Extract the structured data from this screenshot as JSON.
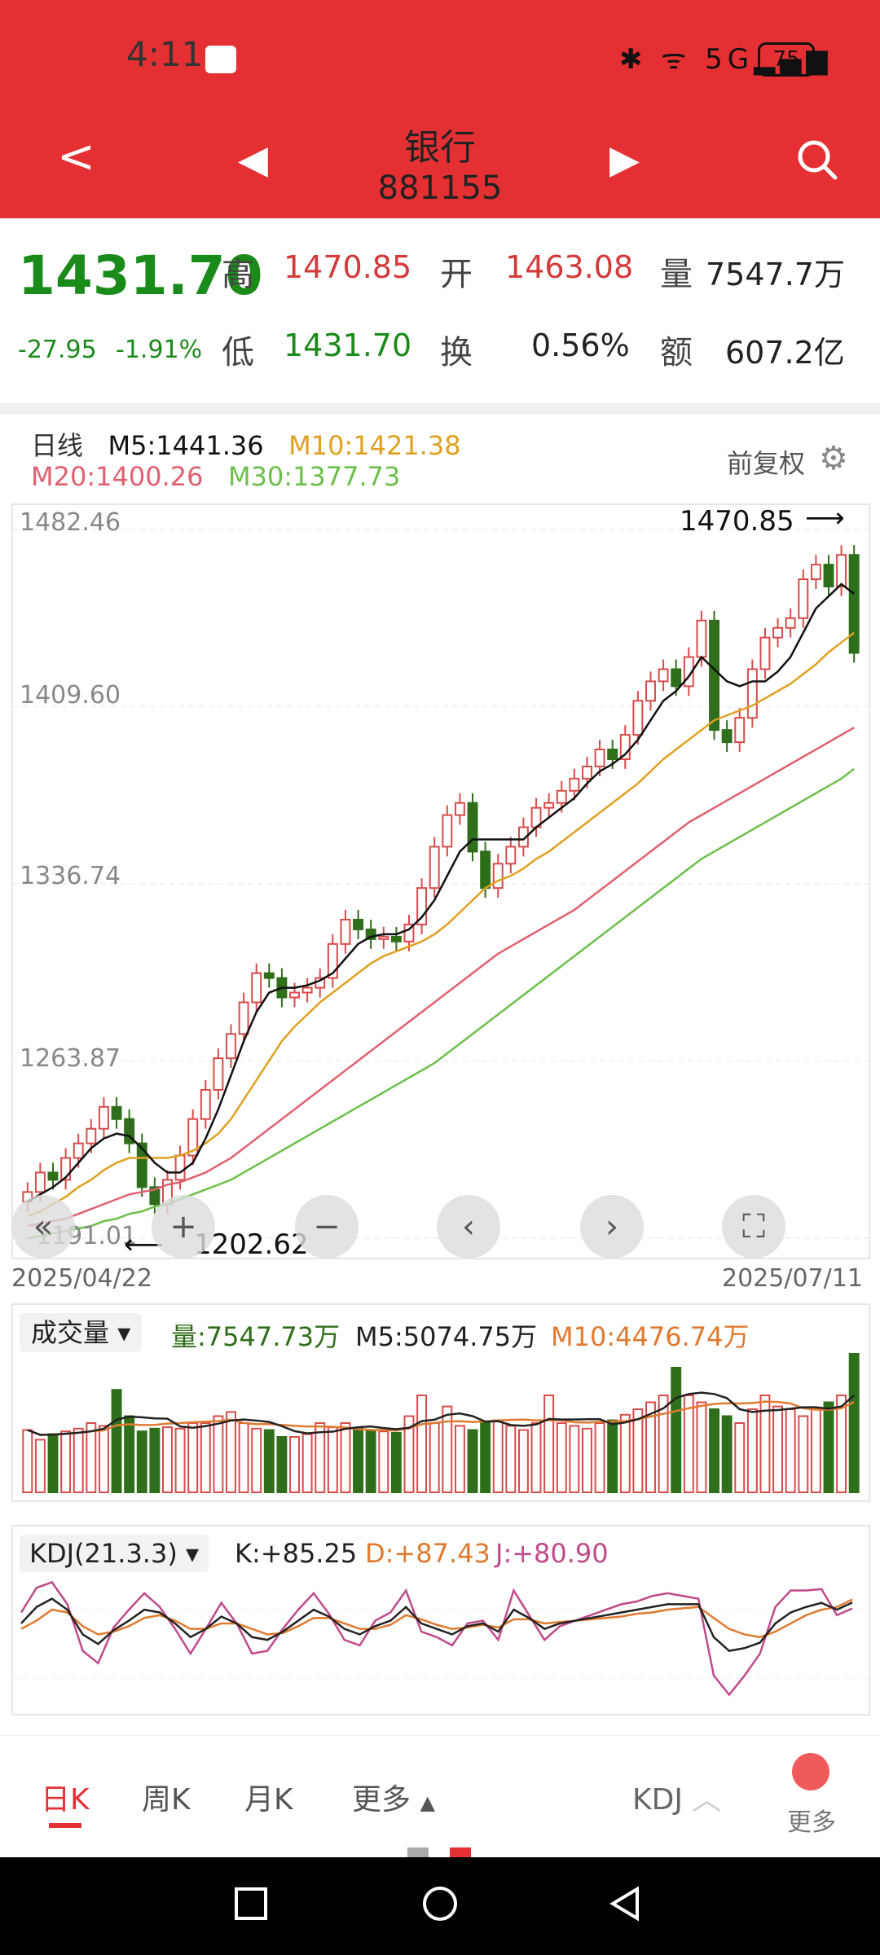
{
  "status": {
    "time": "4:11",
    "battery": "75",
    "net": "5G"
  },
  "header": {
    "title": "银行",
    "code": "881155",
    "back": "<",
    "prev": "◀",
    "next": "▶"
  },
  "quote": {
    "price": "1431.70",
    "change": "-27.95",
    "pct": "-1.91%",
    "high_label": "高",
    "high": "1470.85",
    "open_label": "开",
    "open": "1463.08",
    "vol_label": "量",
    "vol": "7547.7万",
    "low_label": "低",
    "low": "1431.70",
    "turn_label": "换",
    "turn": "0.56%",
    "amt_label": "额",
    "amt": "607.2亿"
  },
  "chart_header": {
    "period": "日线",
    "m5": "M5:1441.36",
    "m10": "M10:1421.38",
    "m20": "M20:1400.26",
    "m30": "M30:1377.73",
    "adjust": "前复权"
  },
  "chart_data": {
    "type": "candlestick",
    "y_ticks": [
      "1482.46",
      "1409.60",
      "1336.74",
      "1263.87",
      "1191.01"
    ],
    "ylim": [
      1191.01,
      1482.46
    ],
    "max_label": "1470.85",
    "min_label": "1202.62",
    "start_date": "2025/04/22",
    "end_date": "2025/07/11",
    "closes": [
      1210,
      1218,
      1215,
      1224,
      1230,
      1236,
      1245,
      1240,
      1230,
      1212,
      1205,
      1215,
      1225,
      1240,
      1252,
      1265,
      1275,
      1288,
      1300,
      1298,
      1290,
      1292,
      1294,
      1298,
      1312,
      1322,
      1318,
      1314,
      1315,
      1313,
      1320,
      1335,
      1352,
      1365,
      1370,
      1350,
      1335,
      1345,
      1352,
      1360,
      1368,
      1370,
      1375,
      1380,
      1385,
      1392,
      1388,
      1398,
      1412,
      1420,
      1425,
      1418,
      1430,
      1445,
      1400,
      1395,
      1405,
      1425,
      1438,
      1442,
      1446,
      1462,
      1468,
      1459,
      1472,
      1431.7
    ],
    "m5": [
      1206,
      1209,
      1212,
      1216,
      1222,
      1228,
      1232,
      1234,
      1233,
      1228,
      1222,
      1218,
      1218,
      1222,
      1232,
      1244,
      1258,
      1272,
      1284,
      1292,
      1294,
      1294,
      1295,
      1297,
      1300,
      1306,
      1312,
      1315,
      1316,
      1316,
      1318,
      1323,
      1330,
      1340,
      1350,
      1355,
      1355,
      1355,
      1355,
      1355,
      1360,
      1364,
      1368,
      1372,
      1378,
      1383,
      1386,
      1390,
      1396,
      1404,
      1412,
      1416,
      1422,
      1430,
      1425,
      1420,
      1418,
      1420,
      1420,
      1424,
      1430,
      1440,
      1450,
      1455,
      1460,
      1456
    ],
    "m10": [
      1200,
      1202,
      1205,
      1208,
      1212,
      1215,
      1219,
      1222,
      1224,
      1224,
      1224,
      1224,
      1225,
      1227,
      1230,
      1234,
      1240,
      1248,
      1256,
      1264,
      1272,
      1278,
      1283,
      1288,
      1292,
      1296,
      1300,
      1304,
      1307,
      1309,
      1311,
      1313,
      1316,
      1320,
      1325,
      1330,
      1335,
      1338,
      1340,
      1343,
      1347,
      1350,
      1354,
      1358,
      1362,
      1366,
      1370,
      1374,
      1378,
      1383,
      1388,
      1392,
      1396,
      1400,
      1404,
      1406,
      1408,
      1410,
      1413,
      1416,
      1419,
      1423,
      1427,
      1432,
      1436,
      1440
    ],
    "m20": [
      1196,
      1197,
      1198,
      1199,
      1201,
      1203,
      1205,
      1207,
      1209,
      1210,
      1211,
      1213,
      1214,
      1216,
      1218,
      1221,
      1224,
      1228,
      1232,
      1236,
      1240,
      1244,
      1248,
      1252,
      1256,
      1260,
      1264,
      1268,
      1272,
      1276,
      1280,
      1284,
      1288,
      1292,
      1296,
      1300,
      1304,
      1308,
      1311,
      1314,
      1317,
      1320,
      1323,
      1326,
      1330,
      1334,
      1338,
      1342,
      1346,
      1350,
      1354,
      1358,
      1362,
      1365,
      1368,
      1371,
      1374,
      1377,
      1380,
      1383,
      1386,
      1389,
      1392,
      1395,
      1398,
      1401
    ],
    "m30": [
      1191,
      1192,
      1193,
      1194,
      1195,
      1196,
      1198,
      1199,
      1201,
      1202,
      1204,
      1205,
      1207,
      1209,
      1211,
      1213,
      1215,
      1218,
      1221,
      1224,
      1227,
      1230,
      1233,
      1236,
      1239,
      1242,
      1245,
      1248,
      1251,
      1254,
      1257,
      1260,
      1263,
      1267,
      1271,
      1275,
      1279,
      1283,
      1287,
      1291,
      1295,
      1299,
      1303,
      1307,
      1311,
      1315,
      1319,
      1323,
      1327,
      1331,
      1335,
      1339,
      1343,
      1347,
      1350,
      1353,
      1356,
      1359,
      1362,
      1365,
      1368,
      1371,
      1374,
      1377,
      1380,
      1384
    ],
    "volumes": [
      0.45,
      0.38,
      0.42,
      0.44,
      0.46,
      0.5,
      0.48,
      0.74,
      0.55,
      0.44,
      0.46,
      0.47,
      0.46,
      0.5,
      0.5,
      0.55,
      0.58,
      0.5,
      0.46,
      0.45,
      0.4,
      0.4,
      0.42,
      0.5,
      0.47,
      0.5,
      0.46,
      0.45,
      0.44,
      0.43,
      0.55,
      0.7,
      0.5,
      0.62,
      0.48,
      0.45,
      0.5,
      0.52,
      0.48,
      0.45,
      0.5,
      0.7,
      0.5,
      0.48,
      0.46,
      0.5,
      0.52,
      0.56,
      0.6,
      0.65,
      0.7,
      0.9,
      0.7,
      0.65,
      0.6,
      0.55,
      0.5,
      0.6,
      0.7,
      0.62,
      0.6,
      0.55,
      0.6,
      0.65,
      0.7,
      1.0
    ],
    "K": [
      70,
      82,
      88,
      80,
      62,
      55,
      65,
      72,
      80,
      78,
      70,
      60,
      66,
      75,
      70,
      60,
      58,
      64,
      72,
      80,
      75,
      66,
      62,
      68,
      72,
      82,
      70,
      66,
      62,
      68,
      70,
      64,
      80,
      74,
      66,
      70,
      72,
      74,
      76,
      78,
      80,
      82,
      84,
      84,
      84,
      60,
      50,
      52,
      56,
      70,
      78,
      82,
      85,
      80,
      85.25
    ],
    "D": [
      66,
      72,
      80,
      78,
      68,
      62,
      64,
      68,
      74,
      76,
      72,
      66,
      66,
      70,
      70,
      66,
      62,
      63,
      68,
      74,
      74,
      70,
      66,
      66,
      69,
      76,
      73,
      69,
      66,
      67,
      69,
      67,
      73,
      73,
      70,
      71,
      72,
      73,
      74,
      75,
      77,
      78,
      80,
      81,
      82,
      74,
      66,
      62,
      60,
      64,
      70,
      76,
      80,
      82,
      87.43
    ],
    "J": [
      78,
      96,
      100,
      84,
      50,
      41,
      67,
      80,
      92,
      82,
      66,
      48,
      66,
      85,
      70,
      48,
      50,
      66,
      80,
      92,
      77,
      58,
      54,
      72,
      78,
      94,
      64,
      60,
      54,
      70,
      72,
      58,
      94,
      76,
      58,
      68,
      72,
      76,
      80,
      84,
      86,
      90,
      92,
      90,
      88,
      32,
      18,
      32,
      48,
      82,
      94,
      94,
      95,
      76,
      80.9
    ]
  },
  "volume": {
    "label": "成交量",
    "vol": "量:7547.73万",
    "m5": "M5:5074.75万",
    "m10": "M10:4476.74万"
  },
  "kdj": {
    "label": "KDJ(21.3.3)",
    "k": "K:+85.25",
    "d": "D:+87.43",
    "j": "J:+80.90"
  },
  "tabs": {
    "day": "日K",
    "week": "周K",
    "month": "月K",
    "more": "更多",
    "kdj": "KDJ",
    "more2": "更多"
  },
  "colors": {
    "red": "#e53033",
    "up": "#d94b4b",
    "down": "#2f6e1a",
    "ma5": "#111111",
    "ma10": "#e0a020",
    "ma20": "#e06070",
    "ma30": "#6cc04a"
  }
}
